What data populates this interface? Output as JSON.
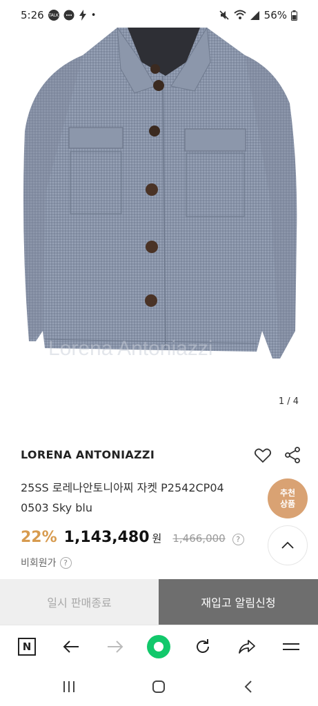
{
  "status_bar": {
    "time": "5:26",
    "talk_badge": "TALK",
    "dot": "•",
    "battery": "56%",
    "icons": [
      "talk-icon",
      "message-icon",
      "bolt-icon",
      "mute-icon",
      "wifi-icon",
      "signal-icon",
      "battery-icon"
    ]
  },
  "gallery": {
    "counter": "1 / 4",
    "watermark": "Lorena Antoniazzi"
  },
  "product": {
    "brand": "LORENA ANTONIAZZI",
    "title_line1": "25SS 로레나안토니아찌 자켓 P2542CP04",
    "title_line2": "0503 Sky blu",
    "discount": "22%",
    "price": "1,143,480",
    "currency": "원",
    "original_price": "1,466,000",
    "member_price_label": "비회원가",
    "help": "?"
  },
  "floating": {
    "recommend_line1": "추천",
    "recommend_line2": "상품"
  },
  "actions": {
    "soldout_label": "일시 판매종료",
    "restock_label": "재입고 알림신청"
  },
  "browser_toolbar": {
    "n_label": "N",
    "items": [
      "naver-icon",
      "back-arrow-icon",
      "forward-arrow-icon",
      "green-home-icon",
      "refresh-icon",
      "share-arrow-icon",
      "menu-icon"
    ]
  },
  "colors": {
    "accent": "#d79b4f",
    "recommend": "#d9a273",
    "action_dark": "#6e6e6e",
    "green": "#12c86b"
  }
}
